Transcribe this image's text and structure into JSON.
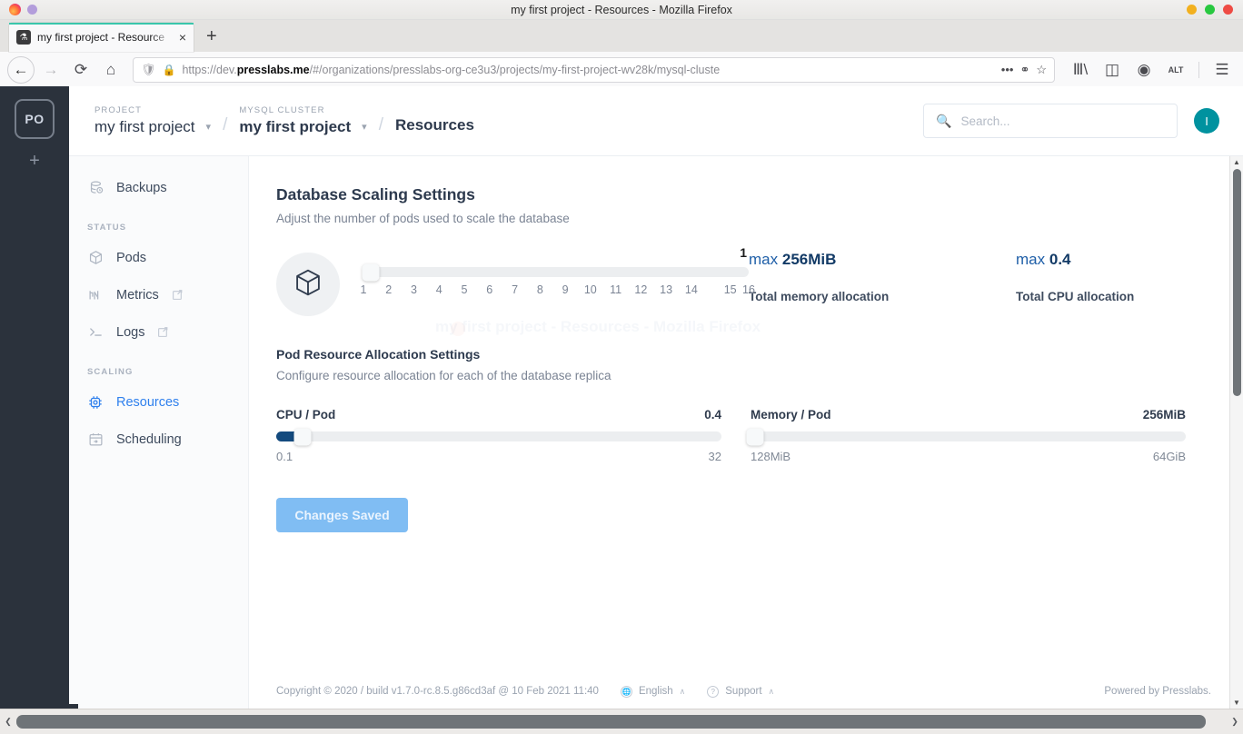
{
  "browser": {
    "window_title": "my first project - Resources - Mozilla Firefox",
    "tab_title": "my first project - Resource",
    "tab_favicon": "flask-icon",
    "tab_close": "×",
    "newtab_label": "+",
    "nav": {
      "back": "←",
      "forward": "→",
      "reload": "⟳",
      "home": "⌂"
    },
    "url": {
      "prefix": "https://dev.",
      "domain": "presslabs.me",
      "path": "/#/organizations/presslabs-org-ce3u3/projects/my-first-project-wv28k/mysql-cluste",
      "shield_icon": "shield-icon",
      "lock_icon": "lock-icon",
      "more_icon": "•••",
      "pocket_icon": "pocket-icon",
      "bookmark_icon": "star-icon"
    },
    "toolbar_icons": [
      "library-icon",
      "sidebar-icon",
      "account-icon",
      "alt-extension-icon",
      "menu-icon"
    ]
  },
  "rail": {
    "org_badge": "PO",
    "add_label": "+"
  },
  "topbar": {
    "project_kicker": "PROJECT",
    "project_name": "my first project",
    "cluster_kicker": "MYSQL CLUSTER",
    "cluster_name": "my first project",
    "separator": "/",
    "current_page": "Resources",
    "search_placeholder": "Search...",
    "avatar_initial": "I"
  },
  "sidebar": {
    "items": [
      {
        "label": "Backups",
        "icon": "database-clock-icon",
        "active": false,
        "external": false
      },
      {
        "label": "Pods",
        "icon": "cube-icon",
        "active": false,
        "external": false
      },
      {
        "label": "Metrics",
        "icon": "chart-pulse-icon",
        "active": false,
        "external": true
      },
      {
        "label": "Logs",
        "icon": "terminal-icon",
        "active": false,
        "external": true
      },
      {
        "label": "Resources",
        "icon": "cpu-chip-icon",
        "active": true,
        "external": false
      },
      {
        "label": "Scheduling",
        "icon": "calendar-arrow-icon",
        "active": false,
        "external": false
      }
    ],
    "group_status": "STATUS",
    "group_scaling": "SCALING"
  },
  "scaling": {
    "title": "Database Scaling Settings",
    "subtitle": "Adjust the number of pods used to scale the database",
    "pod_icon": "cube-icon",
    "pods_value": "1",
    "pods_min": 1,
    "pods_max": 16,
    "pods_ticks": [
      "1",
      "2",
      "3",
      "4",
      "5",
      "6",
      "7",
      "8",
      "9",
      "10",
      "11",
      "12",
      "13",
      "14",
      "15",
      "16"
    ]
  },
  "allocation": {
    "memory": {
      "prefix": "max",
      "value": "256MiB",
      "caption": "Total memory allocation"
    },
    "cpu": {
      "prefix": "max",
      "value": "0.4",
      "caption": "Total CPU allocation"
    }
  },
  "pod_resources": {
    "title": "Pod Resource Allocation Settings",
    "subtitle": "Configure resource allocation for each of the database replica",
    "cpu": {
      "label": "CPU / Pod",
      "value": "0.4",
      "min_label": "0.1",
      "max_label": "32",
      "fill_percent": 6
    },
    "memory": {
      "label": "Memory / Pod",
      "value": "256MiB",
      "min_label": "128MiB",
      "max_label": "64GiB",
      "fill_percent": 0
    },
    "save_button": "Changes Saved"
  },
  "footer": {
    "copyright": "Copyright © 2020 / build v1.7.0-rc.8.5.g86cd3af @ 10 Feb 2021 11:40",
    "language": "English",
    "language_icon": "globe-icon",
    "support": "Support",
    "support_icon": "question-icon",
    "caret": "∧",
    "powered_by": "Powered by Presslabs."
  },
  "ghost_artifact": "my first project - Resources - Mozilla Firefox",
  "colors": {
    "accent_blue": "#2f80ed",
    "dark_navy": "#134a7e",
    "teal_avatar": "#00929f",
    "rail_dark": "#2b323c",
    "tab_accent": "#3ac6ab"
  }
}
